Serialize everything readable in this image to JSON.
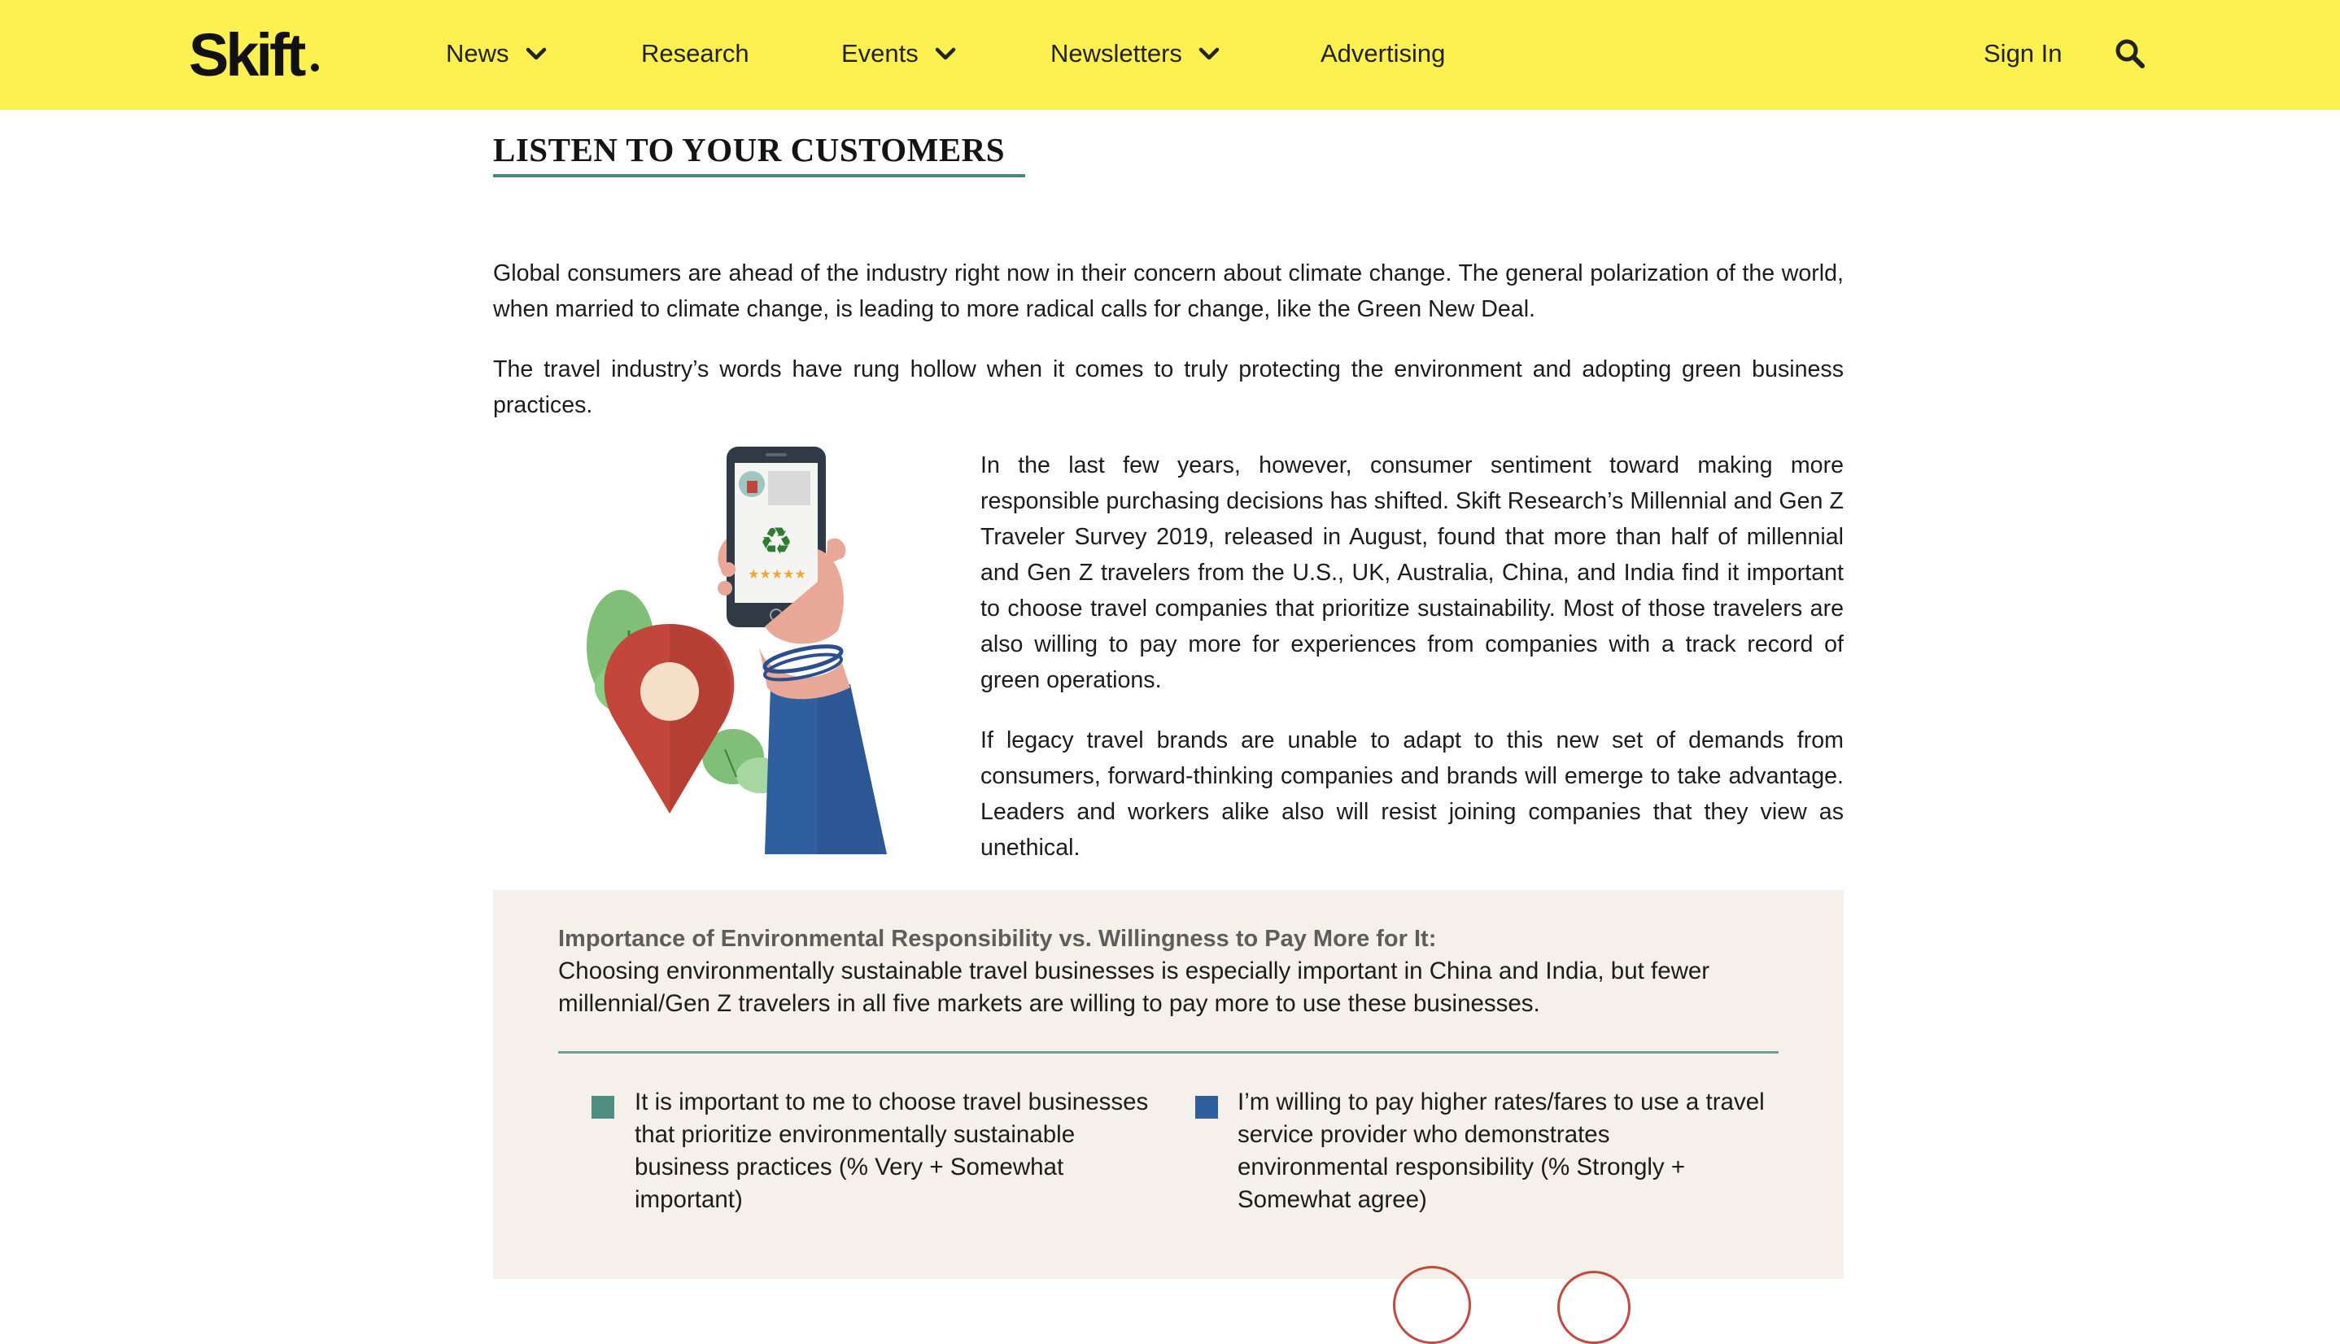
{
  "header": {
    "logo": "Skift",
    "nav": [
      {
        "label": "News",
        "has_dropdown": true
      },
      {
        "label": "Research",
        "has_dropdown": false
      },
      {
        "label": "Events",
        "has_dropdown": true
      },
      {
        "label": "Newsletters",
        "has_dropdown": true
      },
      {
        "label": "Advertising",
        "has_dropdown": false
      }
    ],
    "sign_in": "Sign In",
    "search_icon": "search-icon",
    "background_color": "#fdf152"
  },
  "article": {
    "section_title": "LISTEN TO YOUR CUSTOMERS",
    "paragraphs": [
      "Global consumers are ahead of the industry right now in their concern about climate change. The general polarization of the world, when married to climate change, is leading to more radical calls for change, like the Green New Deal.",
      "The travel industry’s words have rung hollow when it comes to truly protecting the environment and adopting green business practices.",
      "In the last few years, however, consumer sentiment toward making more responsible purchasing decisions has shifted. Skift Research’s Millennial and Gen Z Traveler Survey 2019, released in August, found that more than half of millennial and Gen Z travelers from the U.S., UK, Australia, China, and India find it important to choose travel companies that prioritize sustainability. Most of those travelers are also willing to pay more for experiences from companies with a track record of green operations.",
      "If legacy travel brands are unable to adapt to this new set of demands from consumers, forward-thinking companies and brands will emerge to take advantage. Leaders and workers alike also will resist joining companies that they view as unethical."
    ],
    "illustration": "hand-holding-phone-recycling-illustration"
  },
  "infographic": {
    "title": "Importance of Environmental Responsibility vs. Willingness to Pay More for It:",
    "subtitle": "Choosing environmentally sustainable travel businesses is especially important in China and India, but fewer millennial/Gen Z travelers in all five markets are willing to pay more to use these businesses.",
    "legend": [
      {
        "label": "It is important to me to choose travel businesses that prioritize environmentally sustainable business practices (% Very + Somewhat important)",
        "color": "#4e8e80"
      },
      {
        "label": "I’m willing to pay higher rates/fares to use a travel service provider who demonstrates environmental responsibility (% Strongly + Somewhat agree)",
        "color": "#2f5e9e"
      }
    ],
    "background_color": "#f5f0ea"
  }
}
